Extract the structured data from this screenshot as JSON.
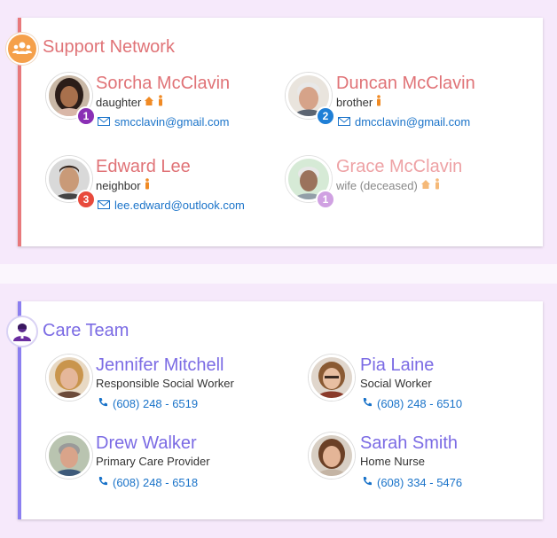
{
  "support": {
    "title": "Support Network",
    "people": [
      {
        "name": "Sorcha McClavin",
        "relation": "daughter",
        "email": "smcclavin@gmail.com",
        "badge": "1",
        "badge_color": "#8a2fb5",
        "home": true,
        "person": true
      },
      {
        "name": "Duncan McClavin",
        "relation": "brother",
        "email": "dmcclavin@gmail.com",
        "badge": "2",
        "badge_color": "#1f7fd6",
        "home": false,
        "person": true
      },
      {
        "name": "Edward Lee",
        "relation": "neighbor",
        "email": "lee.edward@outlook.com",
        "badge": "3",
        "badge_color": "#e84a3c",
        "home": false,
        "person": true
      },
      {
        "name": "Grace McClavin",
        "relation": "wife (deceased)",
        "email": "",
        "badge": "1",
        "badge_color": "#c891de",
        "home": true,
        "person": true
      }
    ]
  },
  "care": {
    "title": "Care Team",
    "people": [
      {
        "name": "Jennifer Mitchell",
        "role": "Responsible Social Worker",
        "phone": "(608) 248 - 6519"
      },
      {
        "name": "Pia Laine",
        "role": "Social Worker",
        "phone": "(608) 248 - 6510"
      },
      {
        "name": "Drew Walker",
        "role": "Primary Care Provider",
        "phone": "(608) 248 - 6518"
      },
      {
        "name": "Sarah Smith",
        "role": "Home Nurse",
        "phone": "(608) 334 - 5476"
      }
    ]
  },
  "colors": {
    "support_accent": "#e07377",
    "care_accent": "#7b6be4",
    "link": "#1a73c9",
    "icon_orange": "#f08a24"
  }
}
